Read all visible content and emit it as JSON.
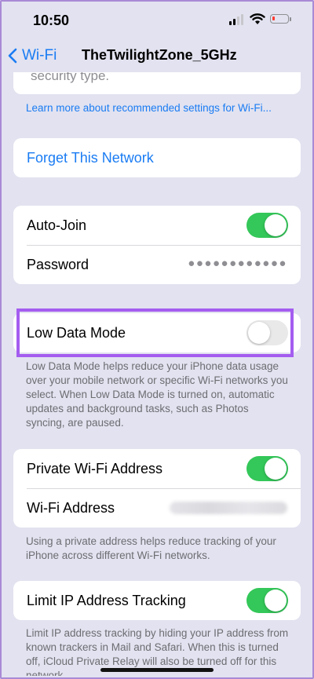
{
  "status_bar": {
    "time": "10:50",
    "battery_level": 0.15,
    "battery_color": "#ff3b30"
  },
  "nav": {
    "back_label": "Wi-Fi",
    "title": "TheTwilightZone_5GHz"
  },
  "security": {
    "partial_text": "security type.",
    "learn_more_link": "Learn more about recommended settings for Wi-Fi..."
  },
  "forget": {
    "label": "Forget This Network"
  },
  "join_group": {
    "auto_join_label": "Auto-Join",
    "auto_join_on": true,
    "password_label": "Password",
    "password_value": "●●●●●●●●●●●●"
  },
  "low_data": {
    "label": "Low Data Mode",
    "on": false,
    "footnote": "Low Data Mode helps reduce your iPhone data usage over your mobile network or specific Wi-Fi networks you select. When Low Data Mode is turned on, automatic updates and background tasks, such as Photos syncing, are paused."
  },
  "private_group": {
    "private_label": "Private Wi-Fi Address",
    "private_on": true,
    "address_label": "Wi-Fi Address",
    "footnote": "Using a private address helps reduce tracking of your iPhone across different Wi-Fi networks."
  },
  "limit_ip": {
    "label": "Limit IP Address Tracking",
    "on": true,
    "footnote": "Limit IP address tracking by hiding your IP address from known trackers in Mail and Safari. When this is turned off, iCloud Private Relay will also be turned off for this network."
  },
  "colors": {
    "accent": "#1a7cf3",
    "toggle_on": "#34c759",
    "highlight": "#a45df0",
    "background": "#e2e2f0"
  }
}
